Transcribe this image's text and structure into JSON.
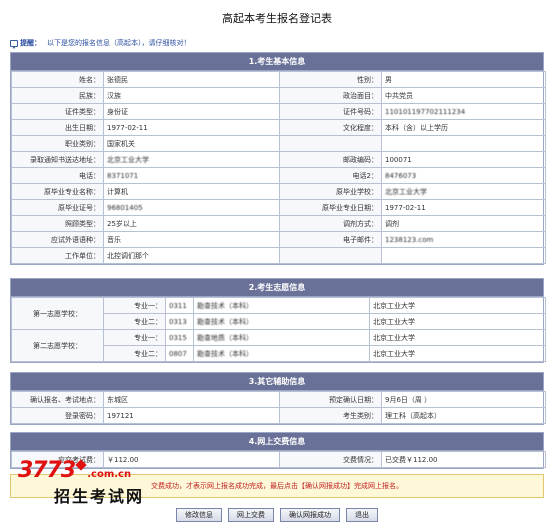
{
  "title": "高起本考生报名登记表",
  "tip": {
    "label": "提醒：",
    "text": "以下是您的报名信息（高起本），请仔细核对！"
  },
  "basic": {
    "header": "1.考生基本信息",
    "rows": [
      [
        {
          "l": "姓名：",
          "v": "张德民"
        },
        {
          "l": "性别：",
          "v": "男"
        }
      ],
      [
        {
          "l": "民族：",
          "v": "汉族"
        },
        {
          "l": "政治面目：",
          "v": "中共党员"
        }
      ],
      [
        {
          "l": "证件类型：",
          "v": "身份证"
        },
        {
          "l": "证件号码：",
          "v": "110101197702111234"
        }
      ],
      [
        {
          "l": "出生日期：",
          "v": "1977-02-11"
        },
        {
          "l": "文化程度：",
          "v": "本科（含）以上学历"
        }
      ],
      [
        {
          "l": "职业类别：",
          "v": "国家机关"
        },
        {
          "l": "",
          "v": ""
        }
      ],
      [
        {
          "l": "录取通知书送达地址：",
          "v": "北京工业大学"
        },
        {
          "l": "邮政编码：",
          "v": "100071"
        }
      ],
      [
        {
          "l": "电话：",
          "v": "8371071"
        },
        {
          "l": "电话2：",
          "v": "8476073"
        }
      ],
      [
        {
          "l": "原毕业专业名称：",
          "v": "计算机"
        },
        {
          "l": "原毕业学校：",
          "v": "北京工业大学"
        }
      ],
      [
        {
          "l": "原毕业证号：",
          "v": "96801405"
        },
        {
          "l": "原毕业专业日期：",
          "v": "1977-02-11"
        }
      ],
      [
        {
          "l": "照顾类型：",
          "v": "25岁以上"
        },
        {
          "l": "调剂方式：",
          "v": "调剂"
        }
      ],
      [
        {
          "l": "应试外语语种：",
          "v": "音乐"
        },
        {
          "l": "电子邮件：",
          "v": "1238123.com"
        }
      ],
      [
        {
          "l": "工作单位：",
          "v": "北控调们那个"
        },
        {
          "l": "",
          "v": ""
        }
      ]
    ]
  },
  "choice": {
    "header": "2.考生志愿信息",
    "groups": [
      {
        "label": "第一志愿学校：",
        "items": [
          {
            "l": "专业一：",
            "code": "0311",
            "name": "勘查技术（本科）",
            "school": "北京工业大学"
          },
          {
            "l": "专业二：",
            "code": "0313",
            "name": "勘查技术（本科）",
            "school": "北京工业大学"
          }
        ]
      },
      {
        "label": "第二志愿学校：",
        "items": [
          {
            "l": "专业一：",
            "code": "0315",
            "name": "勘查地质（本科）",
            "school": "北京工业大学"
          },
          {
            "l": "专业二：",
            "code": "0807",
            "name": "勘查技术（本科）",
            "school": "北京工业大学"
          }
        ]
      }
    ]
  },
  "other": {
    "header": "3.其它辅助信息",
    "rows": [
      [
        {
          "l": "确认报名、考试地点：",
          "v": "东城区"
        },
        {
          "l": "预定确认日期：",
          "v": "9月6日（周 ）"
        }
      ],
      [
        {
          "l": "登录密码：",
          "v": "197121"
        },
        {
          "l": "考生类别：",
          "v": "理工科（高起本）"
        }
      ]
    ]
  },
  "pay": {
    "header": "4.网上交费信息",
    "fee_label": "应交考试费：",
    "fee_value": "￥112.00",
    "status_label": "交费情况：",
    "status_value": "已交费￥112.00"
  },
  "notice": "交费成功，才表示网上报名成功完成，最后点击【确认网报成功】完成网上报名。",
  "buttons": {
    "edit": "修改信息",
    "pay": "网上交费",
    "confirm": "确认网报成功",
    "exit": "退出"
  },
  "logo": {
    "number": "3773",
    "domain": ".com.cn",
    "sub": "招生考试网"
  }
}
